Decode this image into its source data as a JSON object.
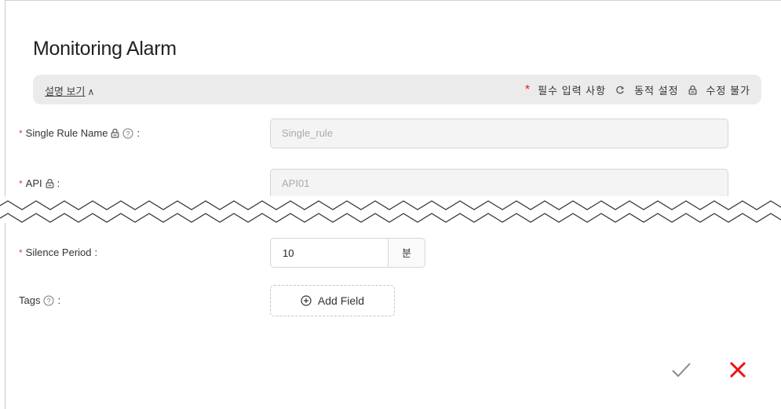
{
  "dialog": {
    "title": "Monitoring Alarm"
  },
  "info_bar": {
    "toggle_label": "설명 보기",
    "toggle_icon": "chevron-up",
    "required_mark": "*",
    "required_text": "필수 입력 사항",
    "dynamic_icon": "refresh-icon",
    "dynamic_text": "동적 설정",
    "lock_icon": "lock-icon",
    "locked_text": "수정 불가"
  },
  "form": {
    "required_mark": "*",
    "colon": ":",
    "rule_name": {
      "label": "Single Rule Name",
      "value": "Single_rule"
    },
    "api": {
      "label": "API",
      "value": "API01"
    },
    "silence_period": {
      "label": "Silence Period",
      "value": "10",
      "unit": "분"
    },
    "tags": {
      "label": "Tags",
      "button_label": "Add Field"
    }
  },
  "actions": {
    "confirm_icon": "check-icon",
    "cancel_icon": "close-icon"
  },
  "colors": {
    "required": "#e02020",
    "cancel": "#ee1111",
    "confirm": "#888888"
  }
}
